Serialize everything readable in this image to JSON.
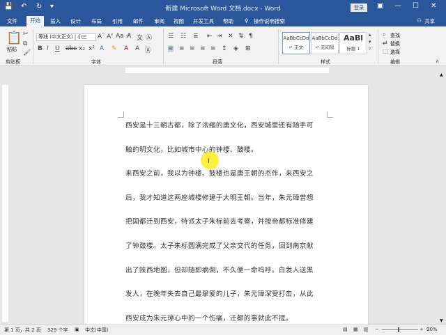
{
  "window": {
    "title": "新建 Microsoft Word 文档.docx - Word",
    "login_label": "登录"
  },
  "tabs": [
    "文件",
    "开始",
    "插入",
    "设计",
    "布局",
    "引用",
    "邮件",
    "审阅",
    "视图",
    "开发工具",
    "帮助"
  ],
  "tell_me": "操作说明搜索",
  "share_label": "共享",
  "clipboard": {
    "paste_label": "粘贴",
    "group_label": "剪贴板"
  },
  "font": {
    "name": "等线 (中文正文)",
    "size": "小三",
    "group_label": "字体"
  },
  "paragraph": {
    "group_label": "段落"
  },
  "styles": {
    "group_label": "样式",
    "items": [
      {
        "preview": "AaBbCcDd",
        "name": "↵ 正文"
      },
      {
        "preview": "AaBbCcDd",
        "name": "↵ 无间隔"
      },
      {
        "preview": "AaBl",
        "name": "标题 1"
      }
    ]
  },
  "editing": {
    "group_label": "编辑",
    "find": "查找",
    "replace": "替换",
    "select": "选择"
  },
  "document": {
    "lines": [
      "西安是十三朝古都，除了浓缩的唐文化，西安城里还有随手可",
      "触的明文化，比如城市中心的钟楼、鼓楼。",
      "来西安之前，我以为钟楼、鼓楼也是唐王朝的杰作，来西安之",
      "后，我才知道这两座城楼修建于大明王朝。当年，朱元璋曾想",
      "把国都迁到西安，特派太子朱标前去考察，并按帝都标准修建",
      "了钟鼓楼。太子朱标圆满完成了父亲交代的任务，回到南京献",
      "出了陕西地图，但却随即病倒，不久便一命呜呼。白发人送黑",
      "发人，在晚年失去自己最挚爱的儿子，朱元璋深受打击，从此",
      "西安成为朱元璋心中的一个伤痛，迁都的事就此不提。"
    ]
  },
  "status": {
    "page": "第 1 页，共 2 页",
    "words": "329 个字",
    "language": "中文(中国)",
    "zoom": "90%"
  }
}
